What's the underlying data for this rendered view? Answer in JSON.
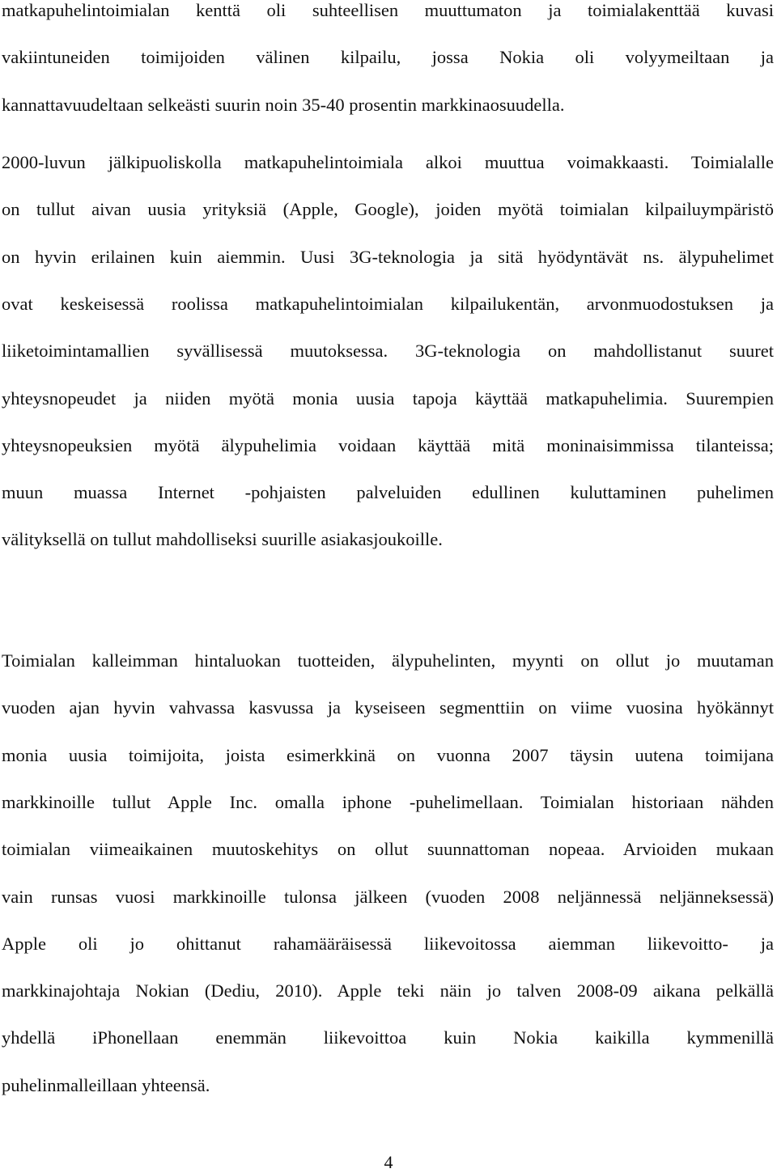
{
  "document": {
    "paragraphs": [
      {
        "lines": [
          {
            "text": "matkapuhelintoimialan kenttä oli suhteellisen muuttumaton ja toimialakenttää kuvasi",
            "justify": true
          },
          {
            "text": "vakiintuneiden toimijoiden välinen kilpailu, jossa Nokia oli volyymeiltaan ja",
            "justify": true
          },
          {
            "text": "kannattavuudeltaan selkeästi suurin noin 35-40 prosentin markkinaosuudella.",
            "justify": false
          }
        ]
      },
      {
        "lines": [
          {
            "text": "2000-luvun jälkipuoliskolla matkapuhelintoimiala alkoi muuttua voimakkaasti. Toimialalle",
            "justify": true
          },
          {
            "text": "on tullut aivan uusia yrityksiä (Apple, Google), joiden myötä toimialan kilpailuympäristö",
            "justify": true
          },
          {
            "text": "on hyvin erilainen kuin aiemmin. Uusi 3G-teknologia ja sitä hyödyntävät ns. älypuhelimet",
            "justify": true
          },
          {
            "text": "ovat keskeisessä roolissa matkapuhelintoimialan kilpailukentän, arvonmuodostuksen ja",
            "justify": true
          },
          {
            "text": "liiketoimintamallien syvällisessä muutoksessa. 3G-teknologia on mahdollistanut suuret",
            "justify": true
          },
          {
            "text": "yhteysnopeudet ja niiden myötä monia uusia tapoja käyttää matkapuhelimia. Suurempien",
            "justify": true
          },
          {
            "text": "yhteysnopeuksien myötä älypuhelimia voidaan käyttää mitä moninaisimmissa tilanteissa;",
            "justify": true
          },
          {
            "text": "muun muassa Internet -pohjaisten palveluiden edullinen kuluttaminen puhelimen",
            "justify": true
          },
          {
            "text": "välityksellä on tullut mahdolliseksi suurille asiakasjoukoille.",
            "justify": false
          }
        ]
      },
      {
        "lines": [
          {
            "text": "Toimialan kalleimman hintaluokan tuotteiden, älypuhelinten, myynti on ollut jo muutaman",
            "justify": true
          },
          {
            "text": "vuoden ajan hyvin vahvassa kasvussa ja kyseiseen segmenttiin on viime vuosina hyökännyt",
            "justify": true
          },
          {
            "text": "monia uusia toimijoita, joista esimerkkinä on vuonna 2007 täysin uutena toimijana",
            "justify": true
          },
          {
            "text": "markkinoille tullut Apple Inc. omalla iphone -puhelimellaan. Toimialan historiaan nähden",
            "justify": true
          },
          {
            "text": "toimialan viimeaikainen muutoskehitys on ollut suunnattoman nopeaa. Arvioiden mukaan",
            "justify": true
          },
          {
            "text": "vain runsas vuosi markkinoille tulonsa jälkeen (vuoden 2008 neljännessä neljänneksessä)",
            "justify": true
          },
          {
            "text": "Apple oli jo ohittanut rahamääräisessä liikevoitossa aiemman liikevoitto- ja",
            "justify": true
          },
          {
            "text": "markkinajohtaja Nokian (Dediu, 2010). Apple teki näin jo talven 2008-09 aikana pelkällä",
            "justify": true
          },
          {
            "text": "yhdellä iPhonellaan enemmän liikevoittoa kuin Nokia kaikilla kymmenillä",
            "justify": true
          },
          {
            "text": "puhelinmalleillaan yhteensä.",
            "justify": false
          }
        ]
      }
    ],
    "page_number": "4"
  }
}
